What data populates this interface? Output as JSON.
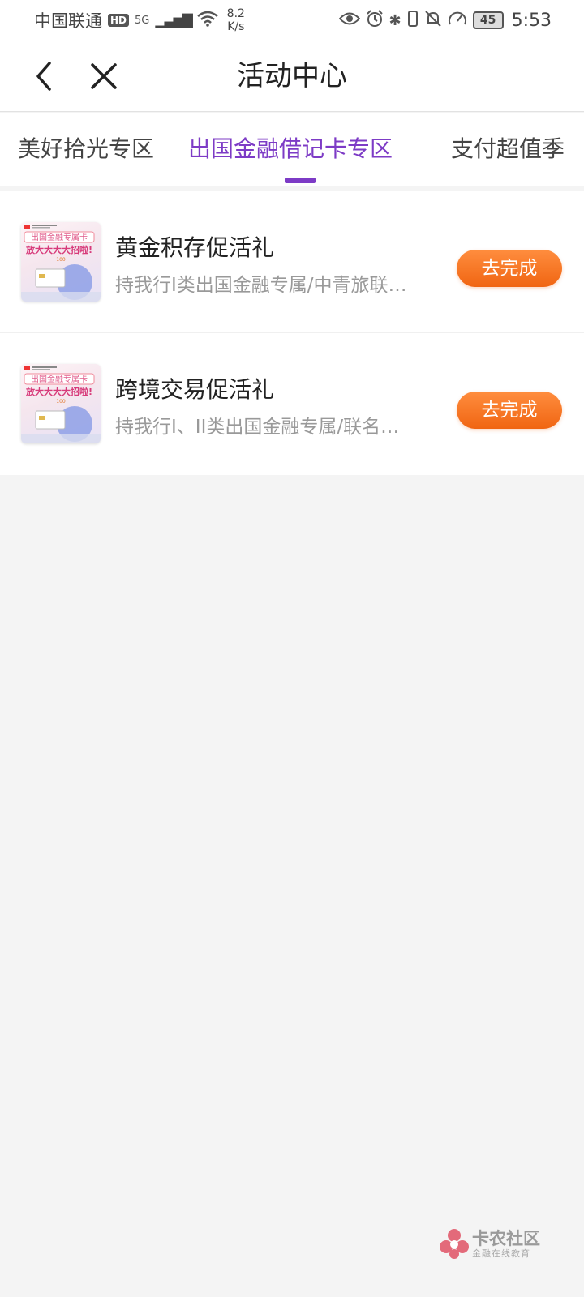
{
  "status_bar": {
    "carrier": "中国联通",
    "hd": "HD",
    "network": "5G",
    "speed_value": "8.2",
    "speed_unit": "K/s",
    "battery": "45",
    "time": "5:53"
  },
  "header": {
    "title": "活动中心",
    "back_icon": "chevron-left-icon",
    "close_icon": "close-icon"
  },
  "tabs": [
    {
      "label": "美好拾光专区",
      "active": false
    },
    {
      "label": "出国金融借记卡专区",
      "active": true
    },
    {
      "label": "支付超值季",
      "active": false
    }
  ],
  "colors": {
    "accent": "#7d3bc6",
    "button_orange": "#f57322",
    "background": "#f4f4f4"
  },
  "items": [
    {
      "title": "黄金积存促活礼",
      "desc": "持我行I类出国金融专属/中青旅联…",
      "button": "去完成",
      "thumb": {
        "line1": "出国金融专属卡",
        "line2": "放大大大大招啦!",
        "line3": "100"
      }
    },
    {
      "title": "跨境交易促活礼",
      "desc": "持我行I、II类出国金融专属/联名…",
      "button": "去完成",
      "thumb": {
        "line1": "出国金融专属卡",
        "line2": "放大大大大招啦!",
        "line3": "100"
      }
    }
  ],
  "watermark": {
    "name": "卡农社区",
    "sub": "金融在线教育"
  }
}
